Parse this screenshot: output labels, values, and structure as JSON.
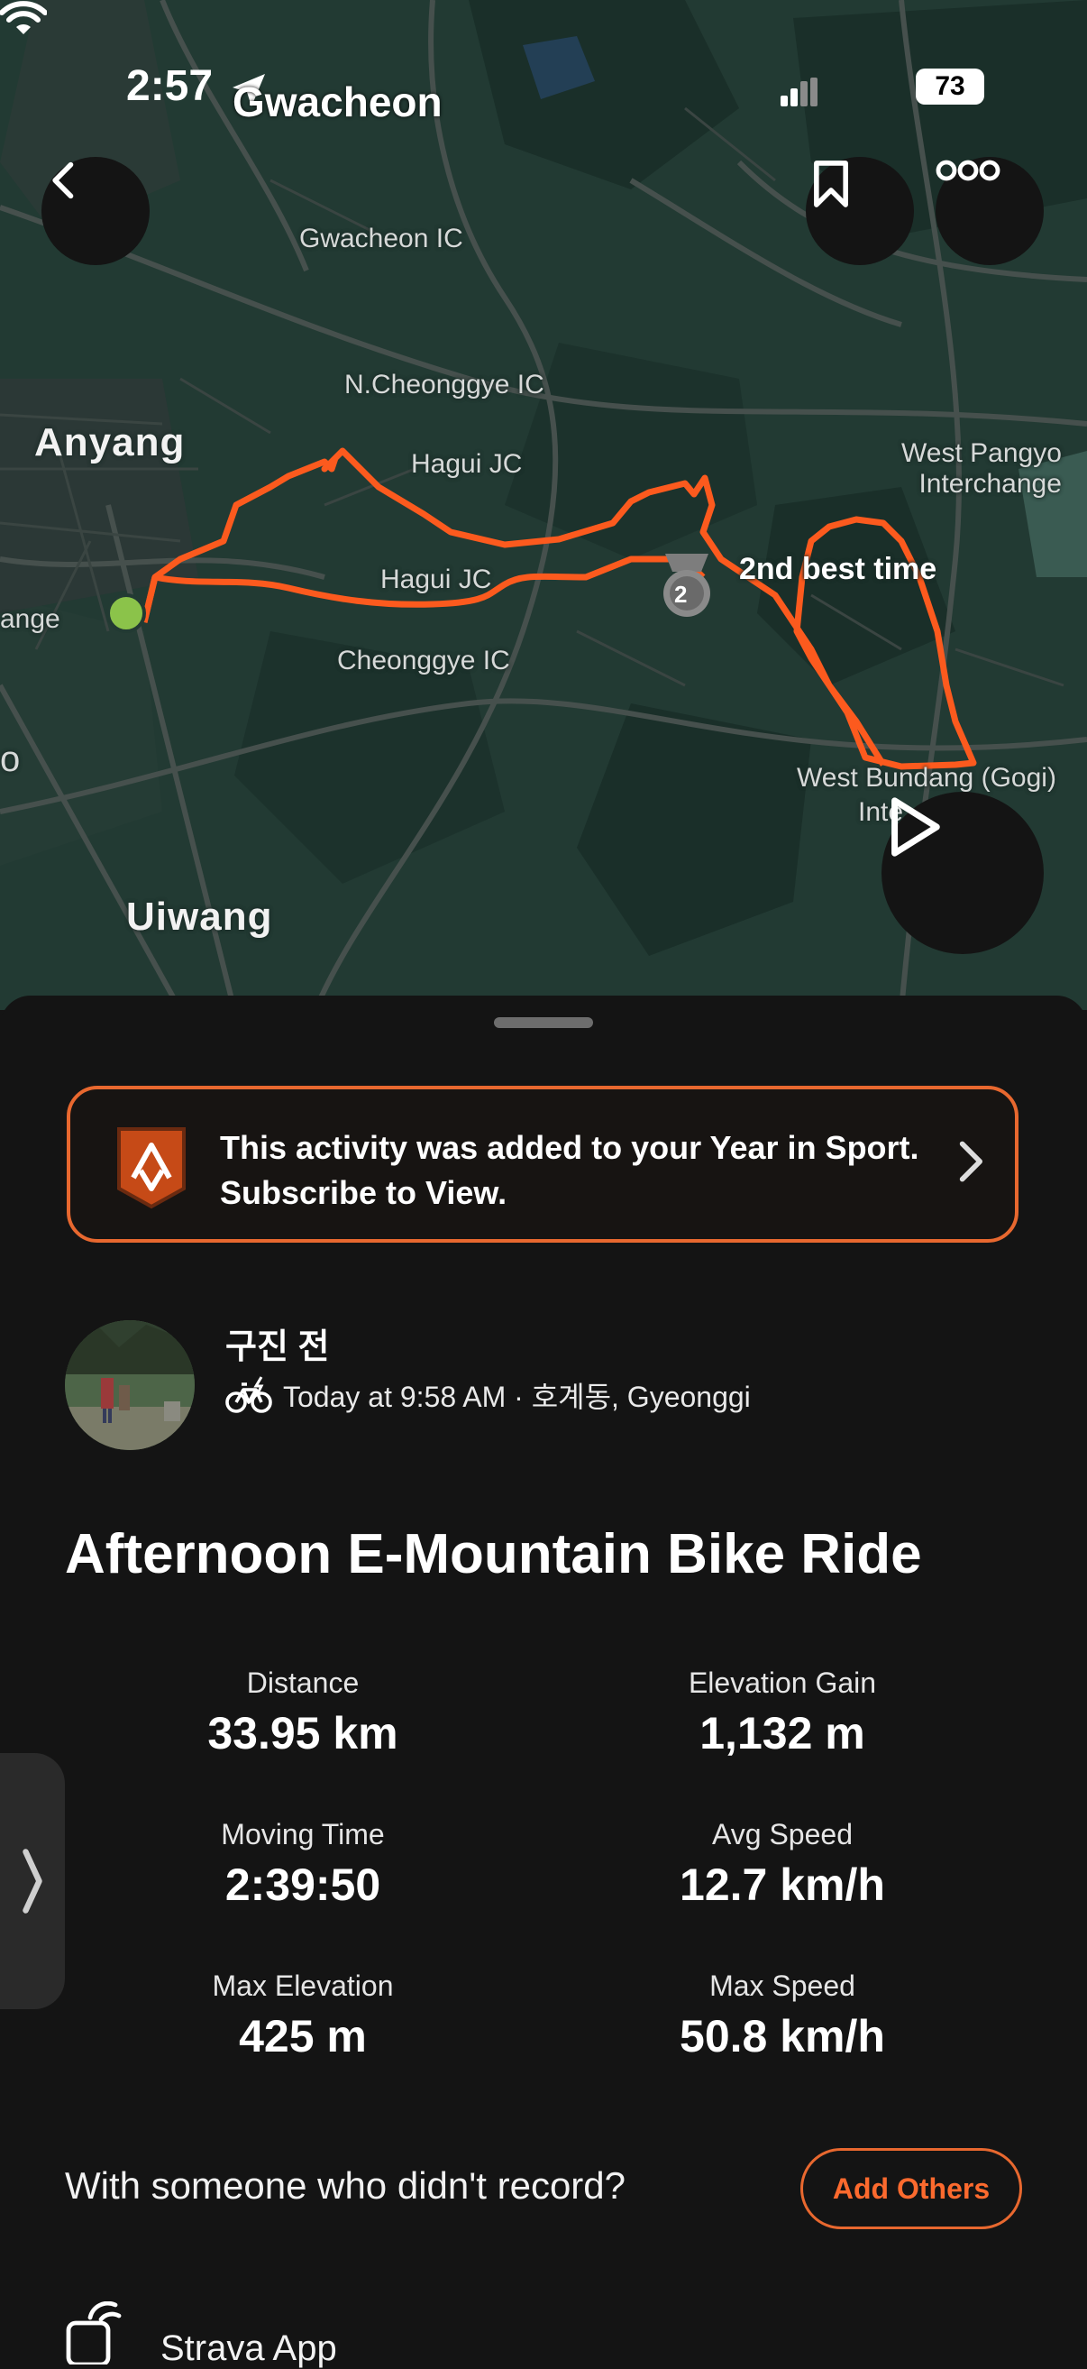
{
  "status_bar": {
    "time": "2:57",
    "battery": "73"
  },
  "map": {
    "location_title": "Gwacheon",
    "labels": {
      "gwacheon_ic": "Gwacheon IC",
      "n_cheonggye_ic": "N.Cheonggye IC",
      "anyang": "Anyang",
      "hagui_jc_top": "Hagui JC",
      "hagui_jc_mid": "Hagui JC",
      "cheonggye_ic": "Cheonggye IC",
      "west_pangyo_1": "West Pangyo",
      "west_pangyo_2": "Interchange",
      "range_partial": "ange",
      "o_partial": "o",
      "west_bundang": "West Bundang (Gogi)",
      "inte_partial": "Inte",
      "uiwang": "Uiwang"
    },
    "achievement": {
      "rank": "2",
      "text": "2nd best time"
    },
    "route_color": "#fc5a1e",
    "start_color": "#8bc34a"
  },
  "buttons": {
    "back_icon": "chevron-left",
    "bookmark_icon": "bookmark",
    "more_icon": "more-horizontal",
    "play_icon": "play"
  },
  "promo": {
    "line1": "This activity was added to your Year in Sport.",
    "line2": "Subscribe to View.",
    "accent": "#e8682f"
  },
  "athlete": {
    "name": "구진 전",
    "meta": "Today at 9:58 AM · 호계동, Gyeonggi",
    "sport_icon": "e-bike-icon"
  },
  "activity": {
    "title": "Afternoon E-Mountain Bike Ride",
    "stats": [
      {
        "label": "Distance",
        "value": "33.95 km"
      },
      {
        "label": "Elevation Gain",
        "value": "1,132 m"
      },
      {
        "label": "Moving Time",
        "value": "2:39:50"
      },
      {
        "label": "Avg Speed",
        "value": "12.7 km/h"
      },
      {
        "label": "Max Elevation",
        "value": "425 m"
      },
      {
        "label": "Max Speed",
        "value": "50.8 km/h"
      }
    ]
  },
  "with_others": {
    "text": "With someone who didn't record?",
    "button": "Add Others"
  },
  "device": {
    "text": "Strava App"
  }
}
